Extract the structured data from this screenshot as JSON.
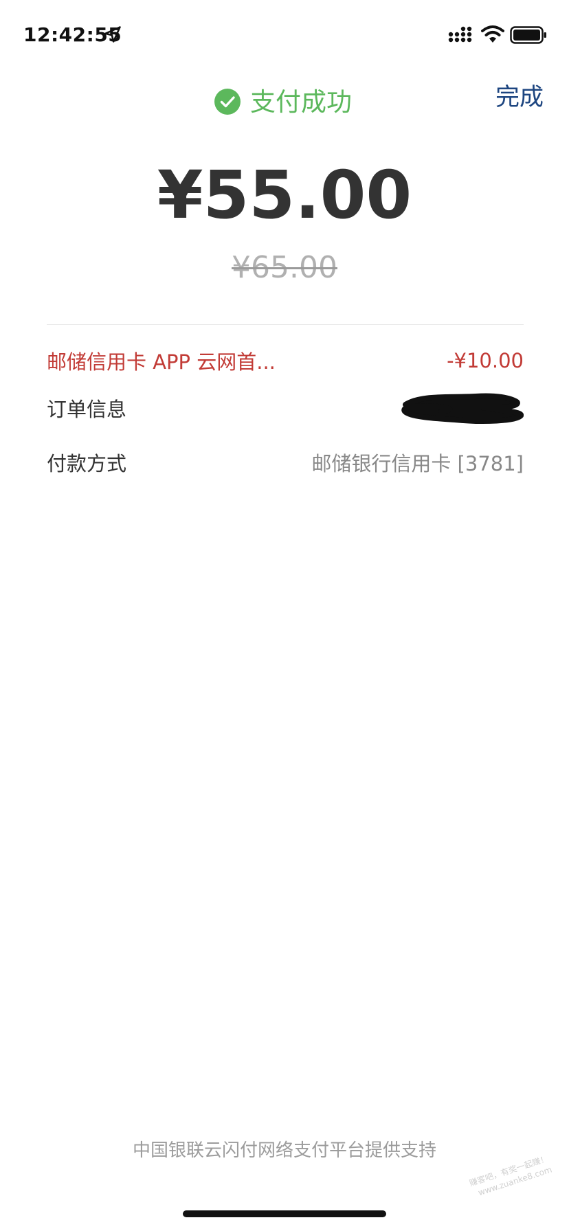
{
  "status_bar": {
    "time": "12:42:55",
    "icons": [
      "location-arrow-icon",
      "cellular-signal-icon",
      "wifi-icon",
      "battery-icon"
    ]
  },
  "header": {
    "status_text": "支付成功",
    "done_label": "完成",
    "icon": "check-circle-icon"
  },
  "payment": {
    "amount": "¥55.00",
    "original_amount": "¥65.00"
  },
  "details": {
    "discount": {
      "label": "邮储信用卡 APP 云网首...",
      "value": "-¥10.00"
    },
    "order": {
      "label": "订单信息",
      "value_redacted": true
    },
    "method": {
      "label": "付款方式",
      "value": "邮储银行信用卡 [3781]"
    }
  },
  "footer": {
    "text": "中国银联云闪付网络支付平台提供支持"
  },
  "watermark": {
    "line1": "赚客吧，有奖一起赚！",
    "line2": "www.zuanke8.com"
  },
  "colors": {
    "success_green": "#5cb85c",
    "done_blue": "#1d4580",
    "discount_red": "#c23b36",
    "amount_dark": "#333333",
    "muted_gray": "#888888"
  }
}
